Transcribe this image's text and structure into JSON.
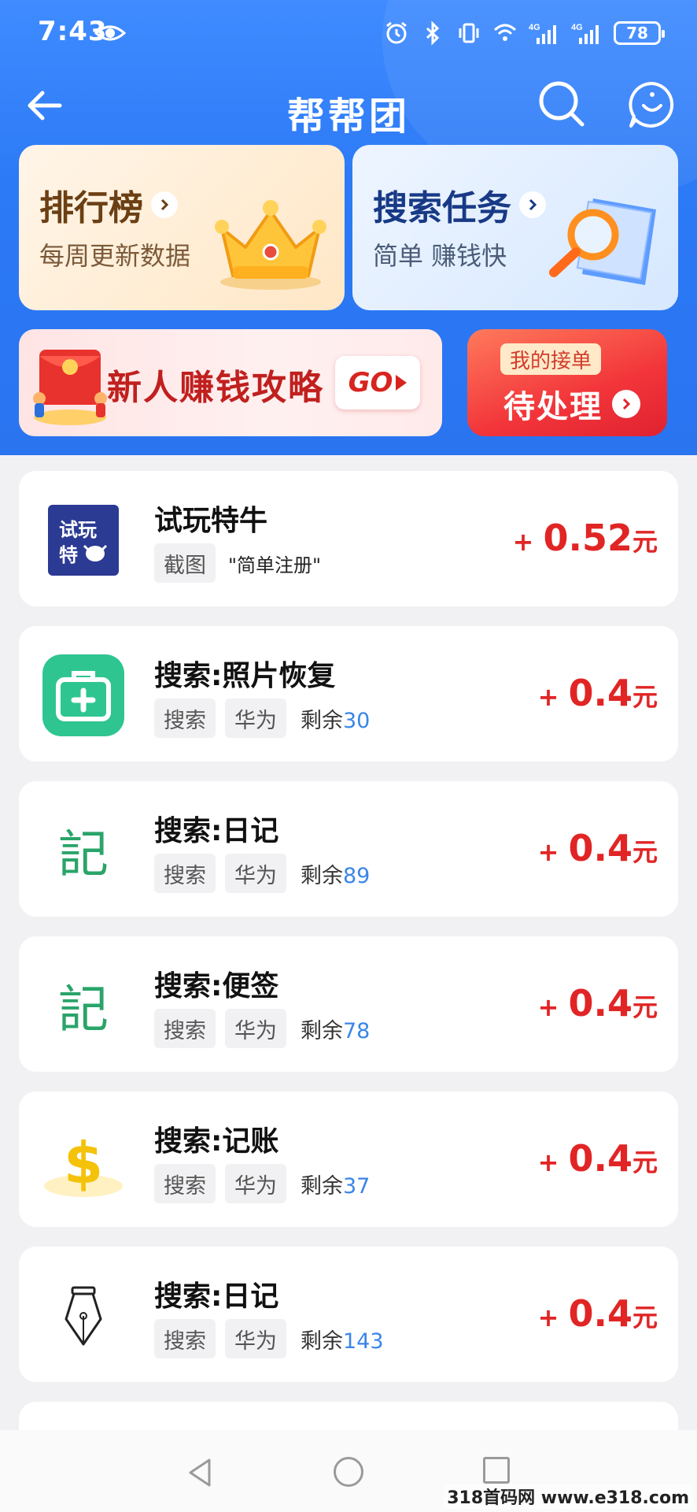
{
  "status_bar": {
    "time": "7:43",
    "battery": "78"
  },
  "nav": {
    "title": "帮帮团"
  },
  "rank_card": {
    "title": "排行榜",
    "subtitle": "每周更新数据"
  },
  "search_card": {
    "title": "搜索任务",
    "subtitle": "简单 赚钱快"
  },
  "guide_banner": {
    "text": "新人赚钱攻略",
    "go_label": "GO"
  },
  "pending_banner": {
    "top_label": "我的接单",
    "main_label": "待处理"
  },
  "tasks": [
    {
      "name": "试玩特牛",
      "tag1": "截图",
      "desc": "\"简单注册\"",
      "plus": "+",
      "amount": "0.52",
      "unit": "元",
      "icon": "shiwan-teniu-app-icon",
      "icon_text_1": "试玩",
      "icon_text_2": "特"
    },
    {
      "name": "搜索:照片恢复",
      "tag1": "搜索",
      "tag2": "华为",
      "remain_label": "剩余",
      "remain": "30",
      "plus": "+",
      "amount": "0.4",
      "unit": "元",
      "icon": "medical-kit-app-icon"
    },
    {
      "name": "搜索:日记",
      "tag1": "搜索",
      "tag2": "华为",
      "remain_label": "剩余",
      "remain": "89",
      "plus": "+",
      "amount": "0.4",
      "unit": "元",
      "icon": "diary-ji-app-icon",
      "icon_glyph": "記"
    },
    {
      "name": "搜索:便签",
      "tag1": "搜索",
      "tag2": "华为",
      "remain_label": "剩余",
      "remain": "78",
      "plus": "+",
      "amount": "0.4",
      "unit": "元",
      "icon": "notes-ji-app-icon",
      "icon_glyph": "記"
    },
    {
      "name": "搜索:记账",
      "tag1": "搜索",
      "tag2": "华为",
      "remain_label": "剩余",
      "remain": "37",
      "plus": "+",
      "amount": "0.4",
      "unit": "元",
      "icon": "dollar-app-icon",
      "icon_glyph": "$"
    },
    {
      "name": "搜索:日记",
      "tag1": "搜索",
      "tag2": "华为",
      "remain_label": "剩余",
      "remain": "143",
      "plus": "+",
      "amount": "0.4",
      "unit": "元",
      "icon": "pen-nib-app-icon"
    }
  ],
  "watermark": "318首码网 www.e318.com",
  "colors": {
    "primary_blue": "#2a74f0",
    "reward_red": "#e12525",
    "remain_blue": "#3a86e8"
  }
}
